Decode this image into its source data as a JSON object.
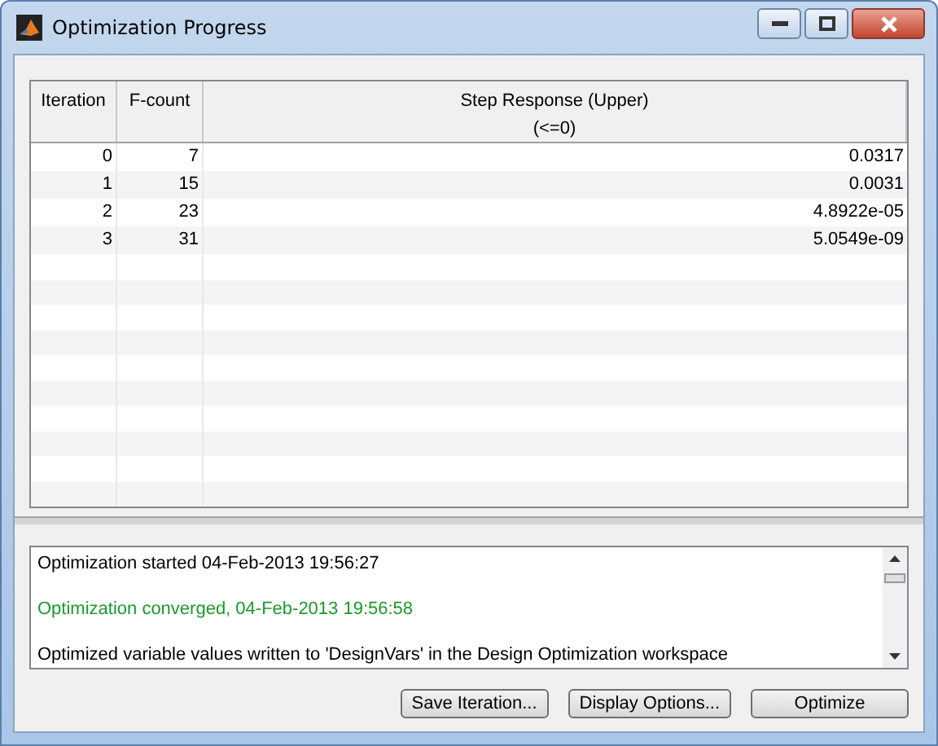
{
  "window": {
    "title": "Optimization Progress"
  },
  "table": {
    "columns": [
      {
        "label": "Iteration"
      },
      {
        "label": "F-count"
      },
      {
        "label": "Step Response (Upper)",
        "sublabel": "(<=0)"
      }
    ],
    "rows": [
      [
        "0",
        "7",
        "0.0317"
      ],
      [
        "1",
        "15",
        "0.0031"
      ],
      [
        "2",
        "23",
        "4.8922e-05"
      ],
      [
        "3",
        "31",
        "5.0549e-09"
      ]
    ]
  },
  "log": [
    {
      "kind": "normal",
      "text": "Optimization started 04-Feb-2013 19:56:27"
    },
    {
      "kind": "success",
      "text": "Optimization converged, 04-Feb-2013 19:56:58"
    },
    {
      "kind": "normal",
      "text": "Optimized variable values written to 'DesignVars' in the Design Optimization workspace"
    }
  ],
  "buttons": [
    "Save Iteration...",
    "Display Options...",
    "Optimize"
  ]
}
